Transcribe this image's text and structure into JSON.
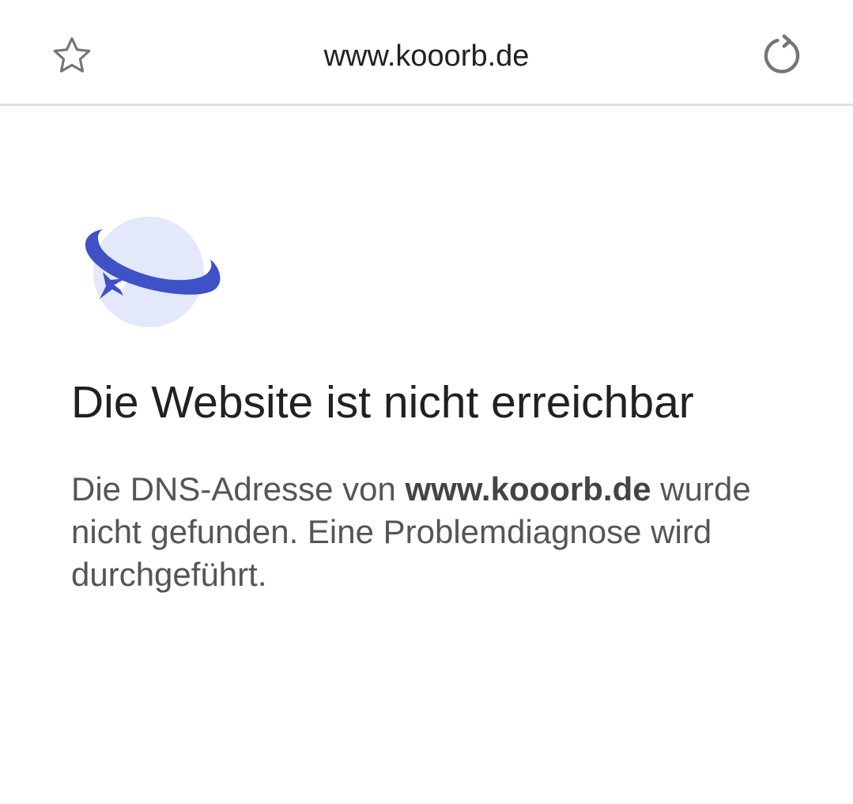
{
  "toolbar": {
    "url": "www.kooorb.de",
    "bookmark_icon": "star-outline-icon",
    "reload_icon": "reload-icon"
  },
  "error": {
    "illustration_icon": "planet-error-icon",
    "title": "Die Website ist nicht erreichbar",
    "message_prefix": "Die DNS-Adresse von ",
    "message_host": "www.kooorb.de",
    "message_suffix": " wurde nicht gefunden. Eine Problemdiagnose wird durchgeführt."
  },
  "colors": {
    "planet_body": "#e3e8fa",
    "planet_ring": "#3f51c7",
    "title_text": "#212121",
    "body_text": "#555555",
    "icon_gray": "#757575"
  }
}
